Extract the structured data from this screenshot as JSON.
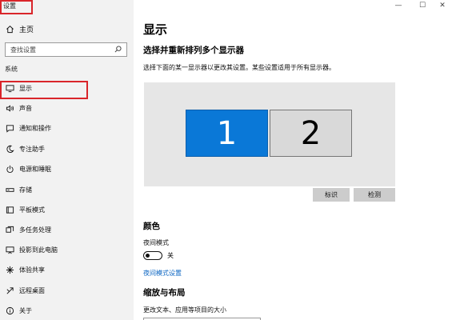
{
  "window": {
    "title": "设置",
    "controls": {
      "minimize": "—",
      "maximize": "☐",
      "close": "✕"
    }
  },
  "sidebar": {
    "home": "主页",
    "search_placeholder": "查找设置",
    "section": "系统",
    "items": [
      {
        "label": "显示",
        "icon": "monitor-icon"
      },
      {
        "label": "声音",
        "icon": "speaker-icon"
      },
      {
        "label": "通知和操作",
        "icon": "notification-icon"
      },
      {
        "label": "专注助手",
        "icon": "moon-icon"
      },
      {
        "label": "电源和睡眠",
        "icon": "power-icon"
      },
      {
        "label": "存储",
        "icon": "storage-icon"
      },
      {
        "label": "平板模式",
        "icon": "tablet-icon"
      },
      {
        "label": "多任务处理",
        "icon": "multitask-icon"
      },
      {
        "label": "投影到此电脑",
        "icon": "project-icon"
      },
      {
        "label": "体验共享",
        "icon": "share-icon"
      },
      {
        "label": "远程桌面",
        "icon": "remote-icon"
      },
      {
        "label": "关于",
        "icon": "info-icon"
      }
    ]
  },
  "main": {
    "title": "显示",
    "rearrange_title": "选择并重新排列多个显示器",
    "rearrange_desc": "选择下面的某一显示器以更改其设置。某些设置适用于所有显示器。",
    "monitors": [
      "1",
      "2"
    ],
    "identify": "标识",
    "detect": "检测",
    "color_title": "颜色",
    "night_light_label": "夜间模式",
    "night_light_state": "关",
    "night_light_link": "夜间模式设置",
    "scale_title": "缩放与布局",
    "scale_desc": "更改文本、应用等项目的大小"
  },
  "colors": {
    "accent": "#0a78d7",
    "highlight": "#d9252a"
  }
}
